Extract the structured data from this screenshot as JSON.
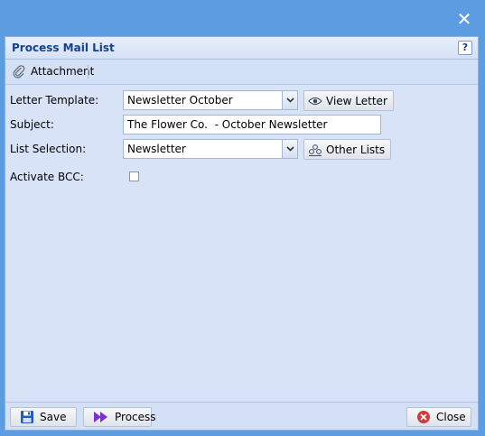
{
  "window": {
    "close_glyph": "✕"
  },
  "dialog": {
    "title": "Process Mail List",
    "help_glyph": "?"
  },
  "toolbar": {
    "attachment_label": "Attachment",
    "attachment_icon": "paperclip-icon"
  },
  "form": {
    "letter_template": {
      "label": "Letter Template:",
      "value": "Newsletter October",
      "button_label": "View Letter",
      "button_icon": "eye-icon"
    },
    "subject": {
      "label": "Subject:",
      "value": "The Flower Co.  - October Newsletter"
    },
    "list_selection": {
      "label": "List Selection:",
      "value": "Newsletter",
      "button_label": "Other Lists",
      "button_icon": "group-icon"
    },
    "activate_bcc": {
      "label": "Activate BCC:",
      "checked": false
    }
  },
  "footer": {
    "save_label": "Save",
    "process_label": "Process",
    "close_label": "Close"
  },
  "colors": {
    "background": "#5b9de0",
    "panel": "#d9e3f8",
    "title": "#15428b",
    "process_icon": "#7b2fd6",
    "close_icon": "#d33b3b",
    "save_icon": "#1d5fb8"
  }
}
